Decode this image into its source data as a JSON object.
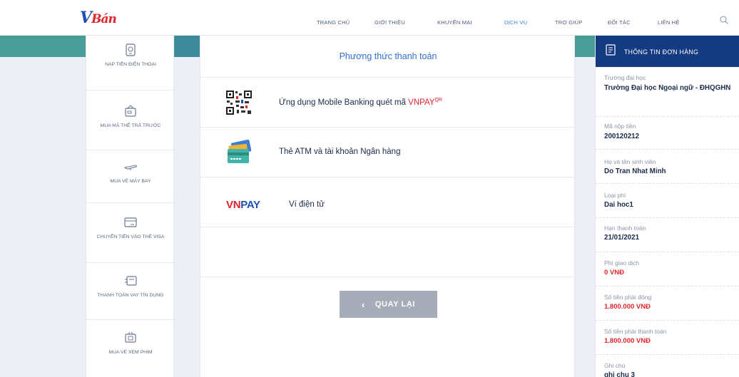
{
  "header": {
    "logo_main": "V",
    "logo_sub": "Bán",
    "nav": [
      "TRANG CHỦ",
      "GIỚI THIỆU",
      "KHUYẾN MẠI",
      "DỊCH VỤ",
      "TRỢ GIÚP",
      "ĐỐI TÁC",
      "LIÊN HỆ"
    ],
    "active_nav": "DỊCH VỤ"
  },
  "sidebar": {
    "items": [
      {
        "label": "NẠP TIỀN ĐIỆN THOẠI",
        "icon": "phone-topup-icon"
      },
      {
        "label": "MUA MÃ THẺ TRẢ TRƯỚC",
        "icon": "prepaid-card-icon"
      },
      {
        "label": "MUA VÉ MÁY BAY",
        "icon": "airplane-icon"
      },
      {
        "label": "CHUYỂN TIỀN VÀO THẺ VISA",
        "icon": "visa-card-icon"
      },
      {
        "label": "THANH TOÁN VAY TÍN DỤNG",
        "icon": "credit-loan-icon"
      },
      {
        "label": "MUA VÉ XEM PHIM",
        "icon": "movie-ticket-icon"
      }
    ]
  },
  "main": {
    "title": "Phương thức thanh toán",
    "methods": [
      {
        "label_prefix": "Ứng dụng Mobile Banking quét mã ",
        "label_brand": "VNPAY",
        "label_sup": "QR",
        "icon": "qr-code-icon"
      },
      {
        "label": "Thẻ ATM và tài khoản Ngân hàng",
        "icon": "bank-card-icon"
      },
      {
        "logo_vn": "VN",
        "logo_pay": "PAY",
        "label": "Ví điện tử",
        "icon": "vnpay-logo"
      }
    ],
    "back_label": "QUAY LẠI"
  },
  "order": {
    "title": "THÔNG TIN ĐƠN HÀNG",
    "fields": [
      {
        "label": "Trường đại học",
        "value": "Trường Đại học Ngoại ngữ - ĐHQGHN",
        "highlight": false
      },
      {
        "label": "Mã nộp tiền",
        "value": "200120212",
        "highlight": false
      },
      {
        "label": "Họ và tên sinh viên",
        "value": "Do Tran Nhat Minh",
        "highlight": false
      },
      {
        "label": "Loại phí",
        "value": "Dai hoc1",
        "highlight": false
      },
      {
        "label": "Hạn thanh toán",
        "value": "21/01/2021",
        "highlight": false
      },
      {
        "label": "Phí giao dịch",
        "value": "0 VNĐ",
        "highlight": true
      },
      {
        "label": "Số tiền phải đóng",
        "value": "1.800.000 VNĐ",
        "highlight": true
      },
      {
        "label": "Số tiền phải thanh toán",
        "value": "1.800.000 VNĐ",
        "highlight": true
      },
      {
        "label": "Ghi chú",
        "value": "ghi chu 3",
        "highlight": false
      }
    ]
  },
  "colors": {
    "accent_blue": "#2f6fd0",
    "navy": "#143a82",
    "teal_band": "#4a9d96",
    "red": "#e0242c"
  }
}
